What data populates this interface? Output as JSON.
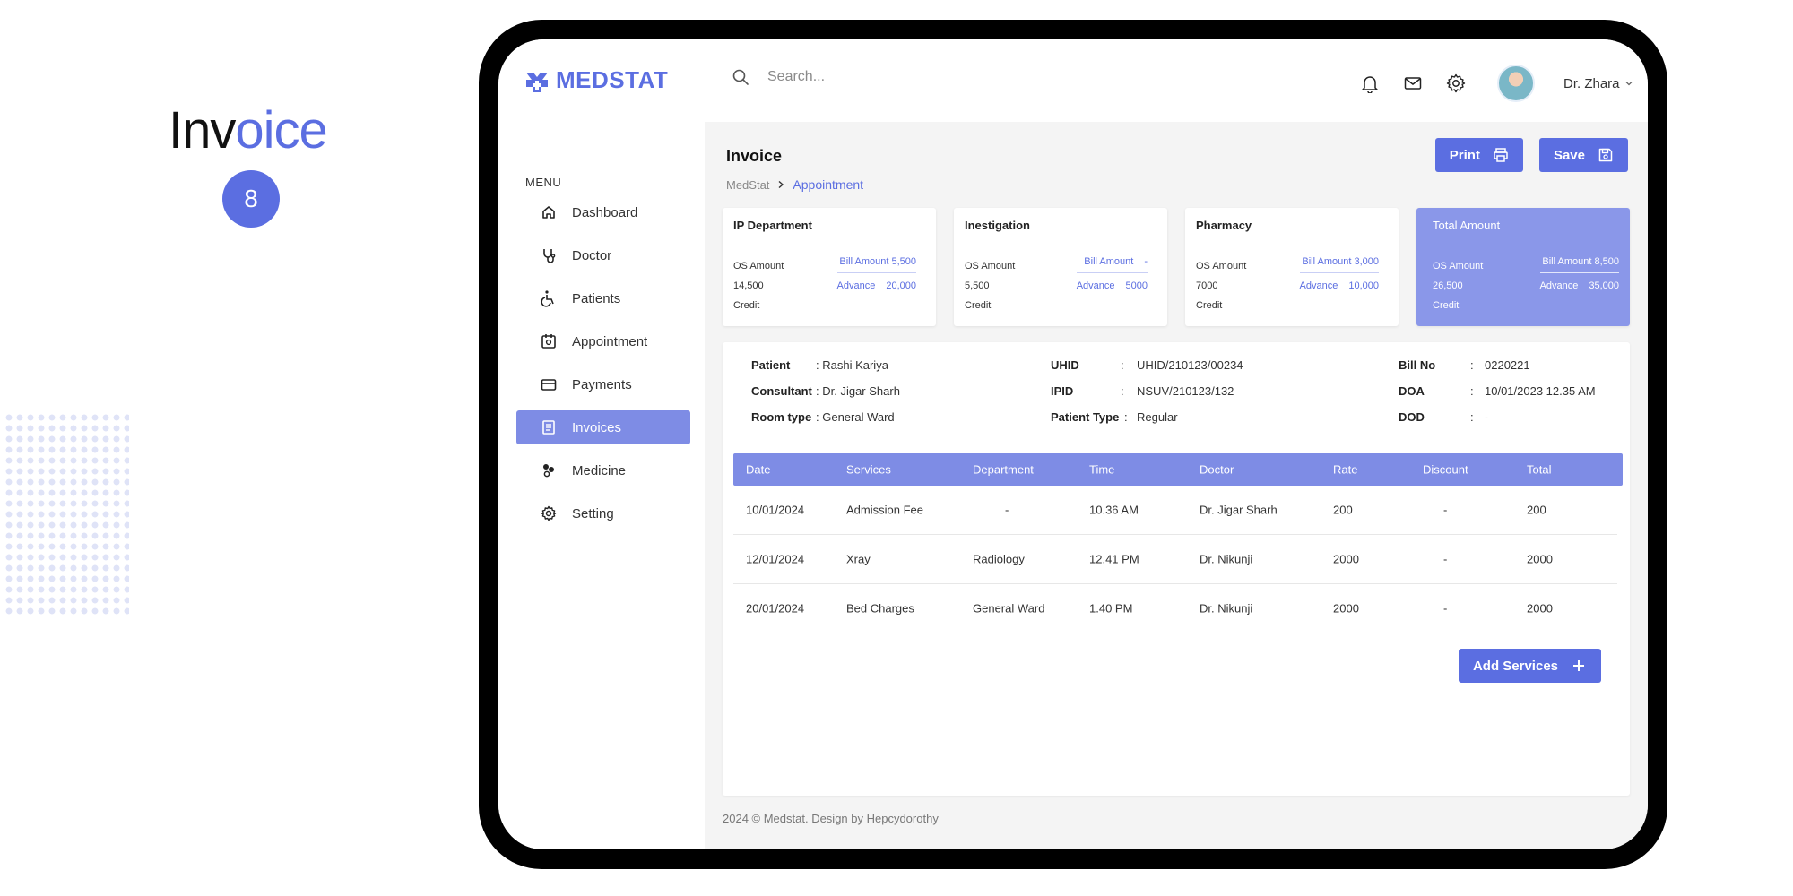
{
  "promo": {
    "title_part1": "Inv",
    "title_part2": "oice",
    "badge": "8"
  },
  "header": {
    "brand": "MEDSTAT",
    "search_placeholder": "Search...",
    "user_name": "Dr. Zhara"
  },
  "sidebar": {
    "menu_label": "MENU",
    "items": [
      {
        "label": "Dashboard",
        "icon": "home-icon"
      },
      {
        "label": "Doctor",
        "icon": "stethoscope-icon"
      },
      {
        "label": "Patients",
        "icon": "wheelchair-icon"
      },
      {
        "label": "Appointment",
        "icon": "calendar-icon"
      },
      {
        "label": "Payments",
        "icon": "card-icon"
      },
      {
        "label": "Invoices",
        "icon": "invoice-icon",
        "active": true
      },
      {
        "label": "Medicine",
        "icon": "pills-icon"
      },
      {
        "label": "Setting",
        "icon": "gear-icon"
      }
    ]
  },
  "page": {
    "title": "Invoice",
    "breadcrumb_root": "MedStat",
    "breadcrumb_current": "Appointment",
    "print_label": "Print",
    "save_label": "Save",
    "add_services_label": "Add Services"
  },
  "cards": [
    {
      "title": "IP Department",
      "os_label": "OS Amount",
      "os_value": "14,500",
      "credit_label": "Credit",
      "bill_label": "Bill Amount",
      "bill_value": "5,500",
      "advance_label": "Advance",
      "advance_value": "20,000"
    },
    {
      "title": "Inestigation",
      "os_label": "OS Amount",
      "os_value": "5,500",
      "credit_label": "Credit",
      "bill_label": "Bill Amount",
      "bill_value": "-",
      "advance_label": "Advance",
      "advance_value": "5000"
    },
    {
      "title": "Pharmacy",
      "os_label": "OS Amount",
      "os_value": "7000",
      "credit_label": "Credit",
      "bill_label": "Bill Amount",
      "bill_value": "3,000",
      "advance_label": "Advance",
      "advance_value": "10,000"
    },
    {
      "title": "Total Amount",
      "os_label": "OS Amount",
      "os_value": "26,500",
      "credit_label": "Credit",
      "bill_label": "Bill Amount",
      "bill_value": "8,500",
      "advance_label": "Advance",
      "advance_value": "35,000"
    }
  ],
  "patient_info": {
    "patient_label": "Patient",
    "patient_value": ": Rashi Kariya",
    "consultant_label": "Consultant",
    "consultant_value": ": Dr. Jigar Sharh",
    "room_label": "Room type",
    "room_value": ": General Ward",
    "uhid_label": "UHID",
    "uhid_value": "UHID/210123/00234",
    "ipid_label": "IPID",
    "ipid_value": "NSUV/210123/132",
    "ptype_label": "Patient Type",
    "ptype_value": "Regular",
    "billno_label": "Bill No",
    "billno_value": "0220221",
    "doa_label": "DOA",
    "doa_value": "10/01/2023  12.35 AM",
    "dod_label": "DOD",
    "dod_value": "-",
    "colon": ":"
  },
  "table": {
    "headers": [
      "Date",
      "Services",
      "Department",
      "Time",
      "Doctor",
      "Rate",
      "Discount",
      "Total"
    ],
    "rows": [
      [
        "10/01/2024",
        "Admission Fee",
        "-",
        "10.36 AM",
        "Dr. Jigar Sharh",
        "200",
        "-",
        "200"
      ],
      [
        "12/01/2024",
        "Xray",
        "Radiology",
        "12.41 PM",
        "Dr. Nikunji",
        "2000",
        "-",
        "2000"
      ],
      [
        "20/01/2024",
        "Bed Charges",
        "General Ward",
        "1.40 PM",
        "Dr. Nikunji",
        "2000",
        "-",
        "2000"
      ]
    ]
  },
  "footer": {
    "text": "2024 © Medstat. Design by Hepcydorothy"
  },
  "colors": {
    "accent": "#5b6ee1",
    "accent_light": "#7e8ce5",
    "total_card": "#8a97e9",
    "main_bg": "#f4f4f4"
  }
}
